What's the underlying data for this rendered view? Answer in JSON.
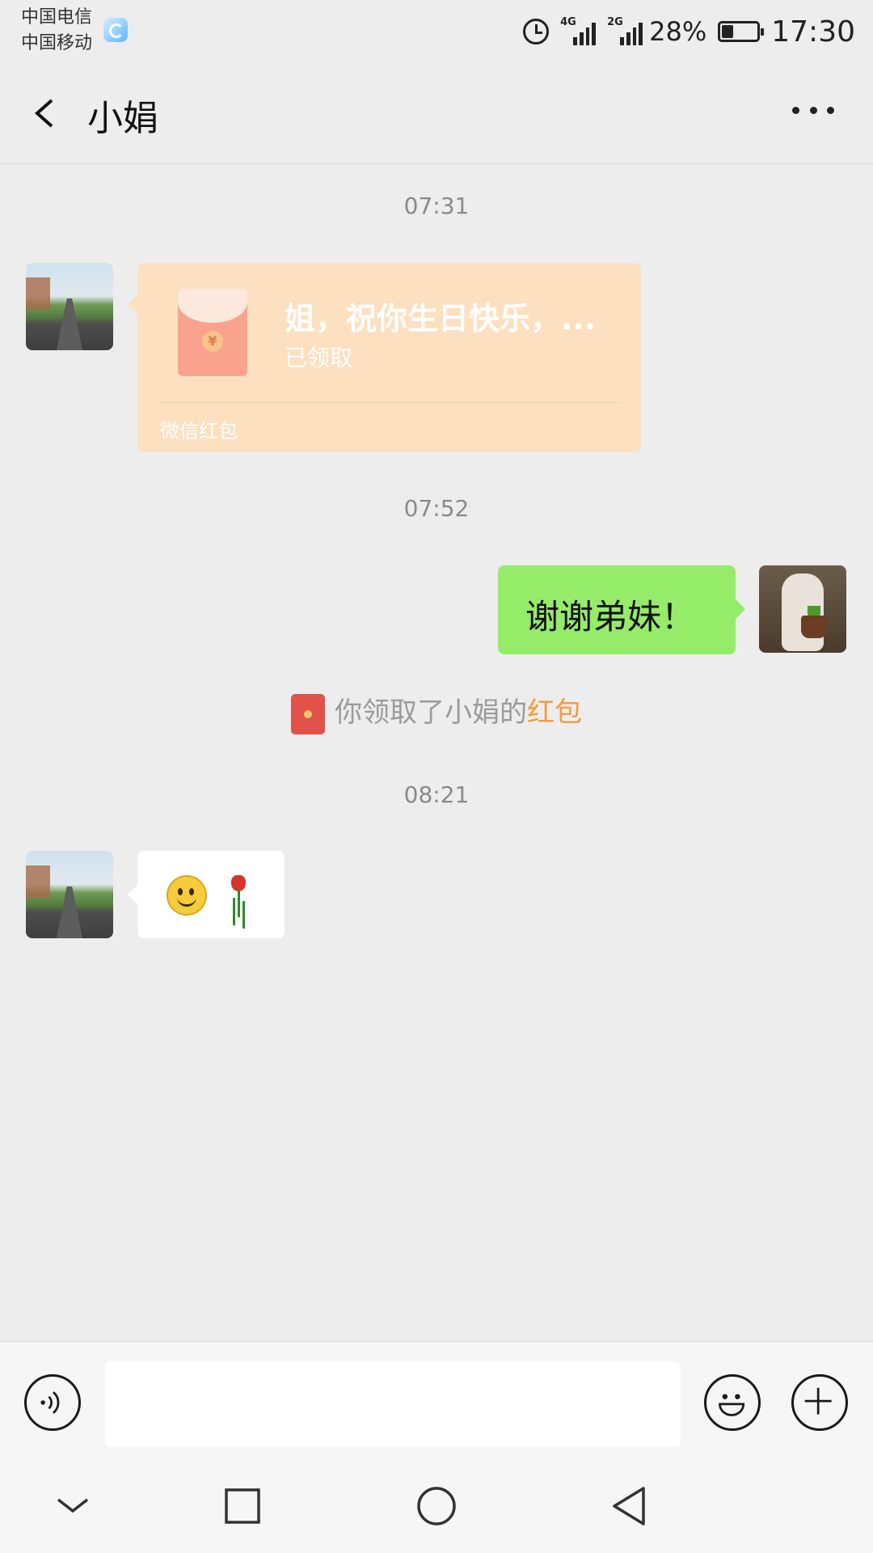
{
  "status_bar": {
    "carrier_1": "中国电信",
    "carrier_2": "中国移动",
    "network_1": "4G",
    "network_2": "2G",
    "battery": "28%",
    "time": "17:30",
    "icons": [
      "hd-app-icon",
      "alarm-icon",
      "signal-icon",
      "signal-icon",
      "battery-icon"
    ]
  },
  "header": {
    "title": "小娟",
    "back_icon": "chevron-left-icon",
    "more_icon": "more-dots-icon"
  },
  "messages": {
    "time_1": "07:31",
    "red_packet": {
      "title": "姐，祝你生日快乐，...",
      "status": "已领取",
      "footer": "微信红包"
    },
    "time_2": "07:52",
    "sent_text": "谢谢弟妹！",
    "notice": {
      "prefix": "你领取了小娟的",
      "link": "红包"
    },
    "time_3": "08:21",
    "emoji_message": [
      "smile-emoji",
      "rose-emoji"
    ]
  },
  "input_bar": {
    "placeholder": "",
    "voice_icon": "voice-icon",
    "emoji_icon": "emoji-icon",
    "plus_icon": "plus-icon"
  },
  "nav_bar": {
    "icons": [
      "chevron-down-icon",
      "square-icon",
      "circle-icon",
      "triangle-back-icon"
    ]
  },
  "colors": {
    "background": "#ededed",
    "sent_bubble": "#95ec69",
    "red_packet": "#fde0c0",
    "link": "#f59a3e"
  }
}
